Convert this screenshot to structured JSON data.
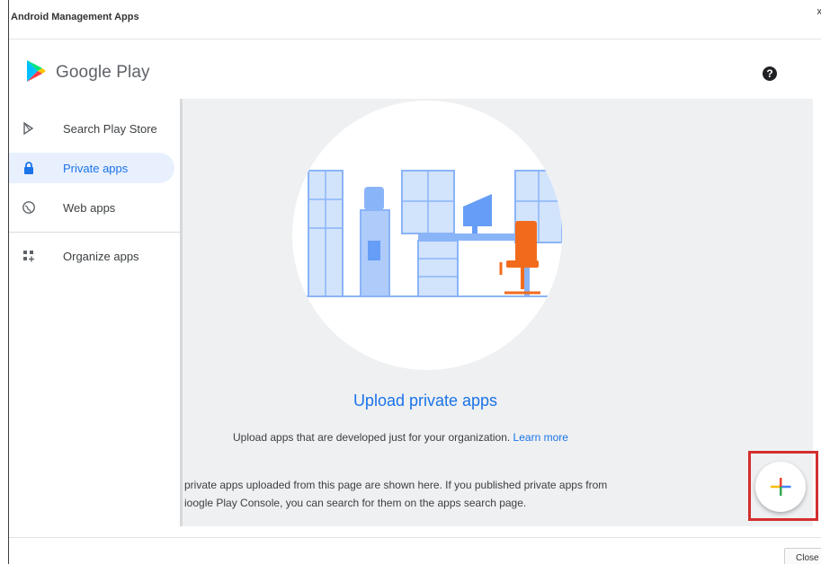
{
  "window": {
    "title": "Android Management Apps",
    "close_glyph": "x"
  },
  "header": {
    "brand": "Google Play",
    "help_glyph": "?"
  },
  "sidebar": {
    "items": [
      {
        "label": "Search Play Store",
        "icon": "play-store-icon",
        "active": false
      },
      {
        "label": "Private apps",
        "icon": "lock-icon",
        "active": true
      },
      {
        "label": "Web apps",
        "icon": "globe-icon",
        "active": false
      },
      {
        "label": "Organize apps",
        "icon": "grid-add-icon",
        "active": false
      }
    ]
  },
  "main": {
    "title": "Upload private apps",
    "description": "Upload apps that are developed just for your organization.",
    "learn_more": "Learn more",
    "info_line1": "private apps uploaded from this page are shown here. If you published private apps from",
    "info_line2": "ioogle Play Console, you can search for them on the apps search page."
  },
  "fab": {
    "icon": "plus-icon"
  },
  "footer": {
    "close_label": "Close"
  },
  "colors": {
    "accent": "#1a73e8",
    "highlight": "#d32f2f",
    "content_bg": "#eef0f2",
    "chair": "#f26b1d",
    "illustration_blue": "#8ab4f8"
  }
}
